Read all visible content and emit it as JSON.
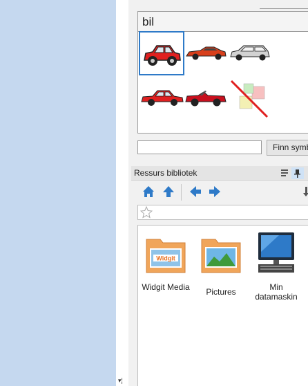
{
  "symbol_panel": {
    "word": "bil",
    "symbols": [
      {
        "name": "red-hatchback-car",
        "selected": true,
        "color": "#e02020"
      },
      {
        "name": "red-sports-car",
        "color": "#d8401c"
      },
      {
        "name": "silver-station-wagon",
        "color": "#c9c9c9"
      },
      {
        "name": "red-sedan",
        "color": "#e02020"
      },
      {
        "name": "red-convertible",
        "color": "#c8101e"
      },
      {
        "name": "no-symbol-crossed",
        "color": "#e02020"
      }
    ]
  },
  "search": {
    "value": "",
    "button_label": "Finn symbol"
  },
  "library": {
    "title": "Ressurs bibliotek",
    "toolbar_icons": [
      "home-icon",
      "up-arrow-icon",
      "back-arrow-icon",
      "forward-arrow-icon"
    ],
    "favorites_icon": "star-icon",
    "items": [
      {
        "label": "Widgit Media",
        "icon": "widgit-folder-icon",
        "folder_text": "Widgit"
      },
      {
        "label": "Pictures",
        "icon": "pictures-folder-icon"
      },
      {
        "label": "Min datamaskin",
        "icon": "computer-icon"
      }
    ]
  },
  "colors": {
    "left_pane": "#c5d8ef",
    "accent": "#2e7ac8",
    "folder": "#f0a55a"
  }
}
